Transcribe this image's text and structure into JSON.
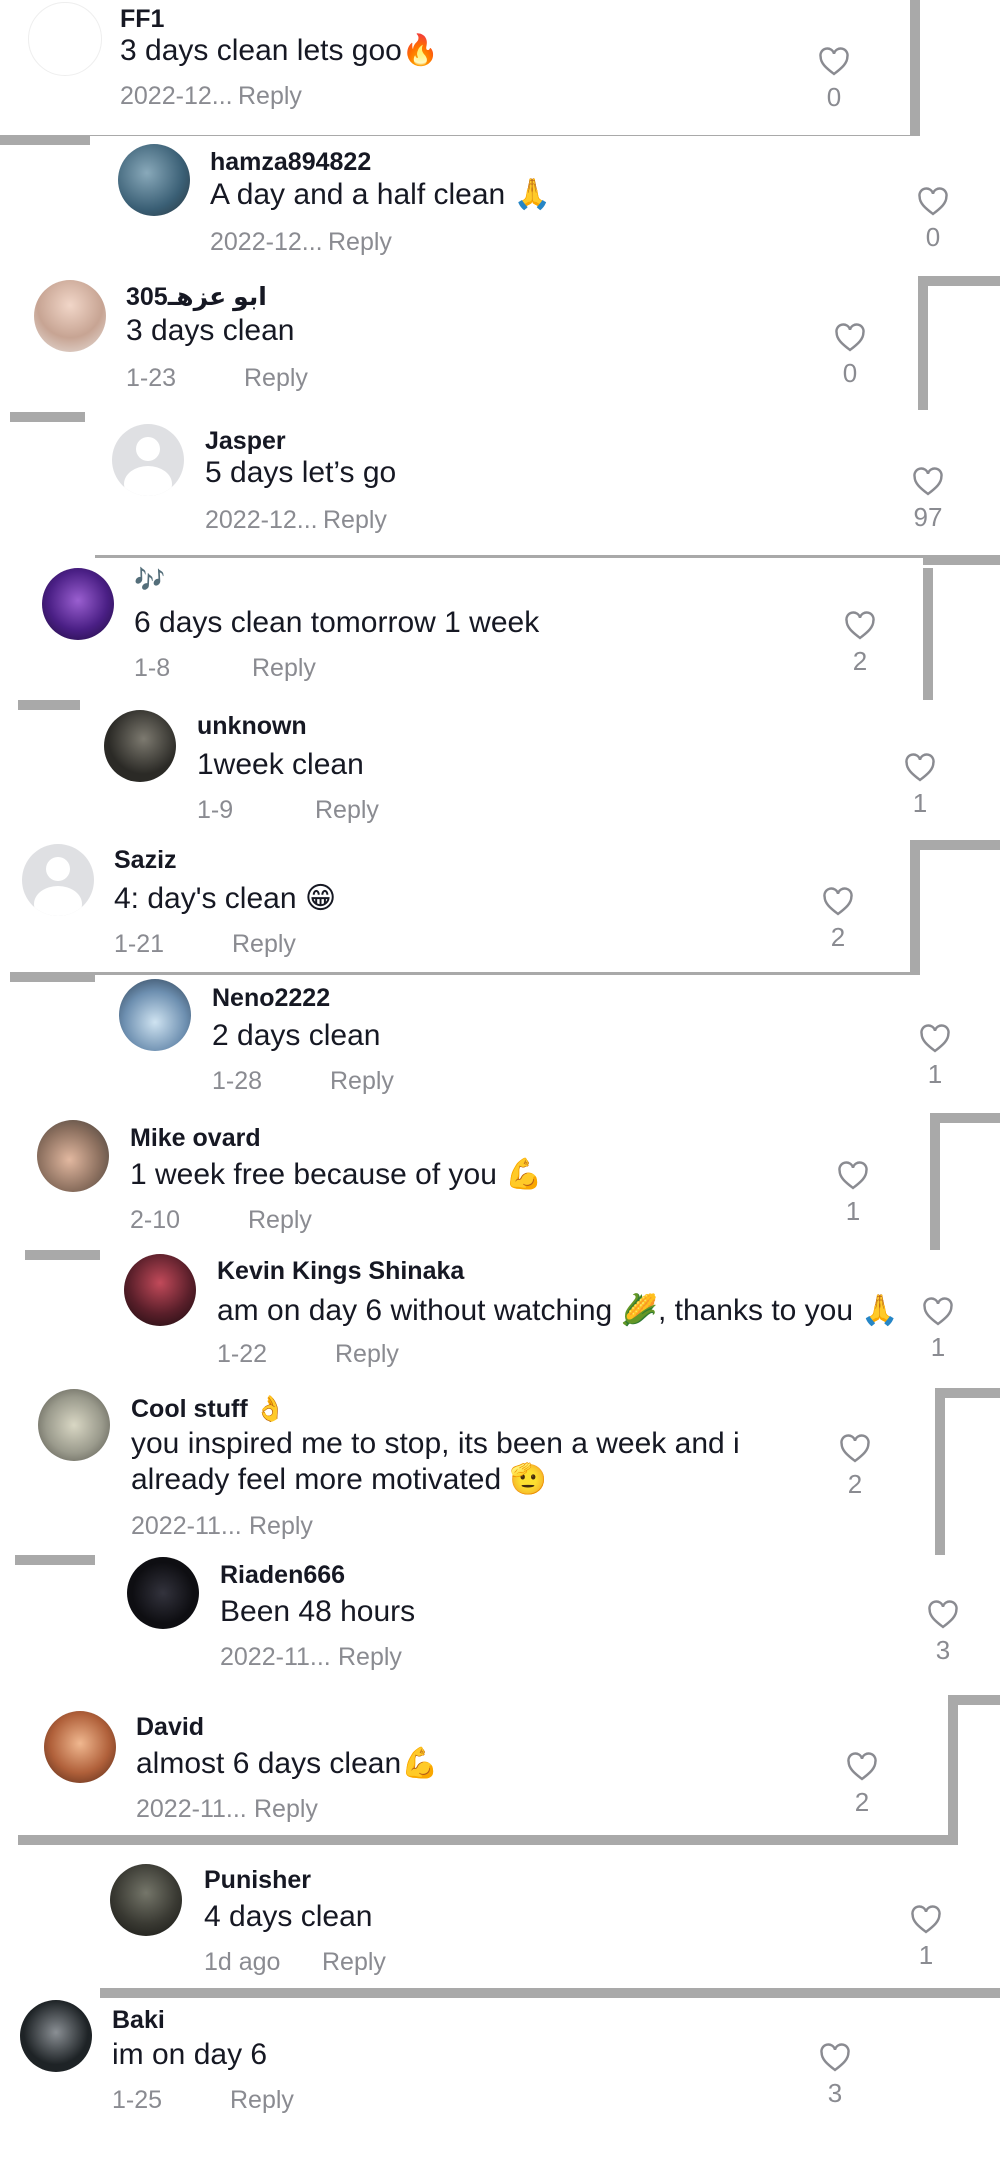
{
  "comments": [
    {
      "user": "FF1",
      "text": "3 days clean lets goo",
      "emoji": "🔥",
      "date": "2022-12...",
      "reply": "Reply",
      "likes": "0",
      "avatar_color": "#ffffff"
    },
    {
      "user": "hamza894822",
      "text": "A day and a half clean ",
      "emoji": "🙏",
      "date": "2022-12...",
      "reply": "Reply",
      "likes": "0",
      "avatar_color": "#4f7c93"
    },
    {
      "user": "305ابو عزهـ",
      "text": "3 days clean",
      "emoji": "🫶",
      "date": "1-23",
      "reply": "Reply",
      "likes": "0",
      "avatar_color": "#d9c3bb"
    },
    {
      "user": "Jasper",
      "text": "5 days let’s go",
      "emoji": "",
      "date": "2022-12...",
      "reply": "Reply",
      "likes": "97",
      "avatar_color": "#dfe0e3"
    },
    {
      "user": "🎶",
      "text": "6 days clean tomorrow 1 week",
      "emoji": "",
      "date": "1-8",
      "reply": "Reply",
      "likes": "2",
      "avatar_color": "#3a1a6b"
    },
    {
      "user": "unknown",
      "text": "1week clean",
      "emoji": "",
      "date": "1-9",
      "reply": "Reply",
      "likes": "1",
      "avatar_color": "#2b2a26"
    },
    {
      "user": "Saziz",
      "text": "4: day's clean ",
      "emoji": "😁",
      "date": "1-21",
      "reply": "Reply",
      "likes": "2",
      "avatar_color": "#dfe0e3"
    },
    {
      "user": "Neno2222",
      "text": "2 days clean",
      "emoji": "",
      "date": "1-28",
      "reply": "Reply",
      "likes": "1",
      "avatar_color": "#6d8fb0"
    },
    {
      "user": "Mike ovard",
      "text": "1 week free because of you ",
      "emoji": "💪",
      "date": "2-10",
      "reply": "Reply",
      "likes": "1",
      "avatar_color": "#8b6f5e"
    },
    {
      "user": "Kevin Kings Shinaka",
      "text": "am on day 6 without watching ",
      "emoji": "🌽",
      "text_after": ", thanks to you ",
      "emoji2": "🙏",
      "date": "1-22",
      "reply": "Reply",
      "likes": "1",
      "avatar_color": "#5a1f2a"
    },
    {
      "user": "Cool stuff 👌",
      "text": "you inspired me to stop, its been a week and i",
      "text2": "already feel more motivated ",
      "emoji": "🫡",
      "date": "2022-11...",
      "reply": "Reply",
      "likes": "2",
      "avatar_color": "#9a9a8c"
    },
    {
      "user": "Riaden666",
      "text": "Been 48 hours",
      "emoji": "",
      "date": "2022-11...",
      "reply": "Reply",
      "likes": "3",
      "avatar_color": "#14141a"
    },
    {
      "user": "David",
      "text": "almost 6 days clean",
      "emoji": "💪",
      "date": "2022-11...",
      "reply": "Reply",
      "likes": "2",
      "avatar_color": "#b0603a"
    },
    {
      "user": "Punisher",
      "text": "4 days clean",
      "emoji": "",
      "date": "1d ago",
      "reply": "Reply",
      "likes": "1",
      "avatar_color": "#3a3a33"
    },
    {
      "user": "Baki",
      "text": "im on day 6",
      "emoji": "",
      "date": "1-25",
      "reply": "Reply",
      "likes": "3",
      "avatar_color": "#1e2326"
    }
  ]
}
